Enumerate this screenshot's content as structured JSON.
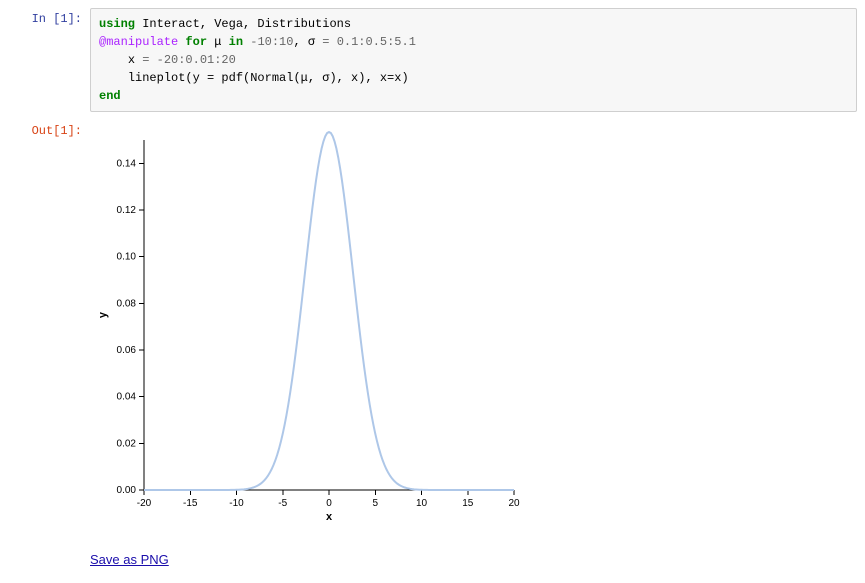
{
  "cell": {
    "in_prompt": "In [1]:",
    "out_prompt": "Out[1]:",
    "code": {
      "kw_using": "using",
      "using_targets": " Interact, Vega, Distributions",
      "macro": "@manipulate",
      "kw_for": "for",
      "mu": "μ",
      "kw_in": "in",
      "range_mu": " -10:10",
      "comma": ", ",
      "sigma": "σ",
      "eq": " = ",
      "range_sigma": "0.1:0.5:5.1",
      "line3_indent": "    ",
      "xvar": "x",
      "range_x": "-20:0.01:20",
      "line4_indent": "    ",
      "lineplot_call": "lineplot(y = pdf(Normal(μ, σ), x), x=x)",
      "kw_end": "end"
    }
  },
  "save_link": "Save as PNG",
  "chart_data": {
    "type": "line",
    "xlabel": "x",
    "ylabel": "y",
    "xlim": [
      -20,
      20
    ],
    "ylim": [
      0,
      0.15
    ],
    "xticks": [
      -20,
      -15,
      -10,
      -5,
      0,
      5,
      10,
      15,
      20
    ],
    "yticks": [
      0.0,
      0.02,
      0.04,
      0.06,
      0.08,
      0.1,
      0.12,
      0.14
    ],
    "series": [
      {
        "name": "pdf",
        "mu": 0,
        "sigma": 2.6,
        "x": [
          -20,
          -19,
          -18,
          -17,
          -16,
          -15,
          -14,
          -13,
          -12,
          -11,
          -10,
          -9,
          -8,
          -7,
          -6,
          -5,
          -4,
          -3,
          -2,
          -1,
          0,
          1,
          2,
          3,
          4,
          5,
          6,
          7,
          8,
          9,
          10,
          11,
          12,
          13,
          14,
          15,
          16,
          17,
          18,
          19,
          20
        ]
      }
    ]
  }
}
